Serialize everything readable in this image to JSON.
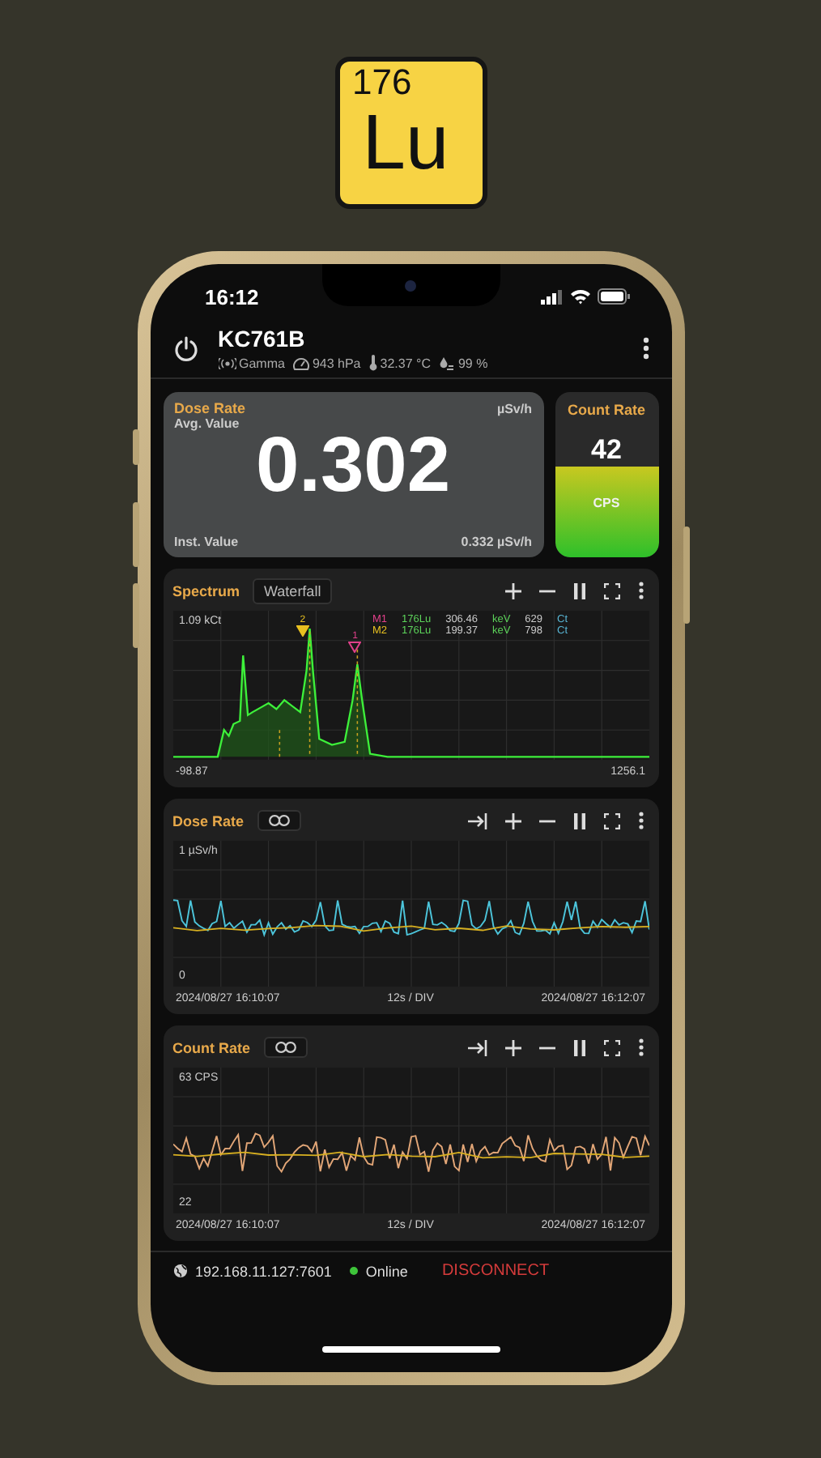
{
  "logo": {
    "mass_number": "176",
    "symbol": "Lu"
  },
  "status_bar": {
    "time": "16:12"
  },
  "device": {
    "name": "KC761B",
    "mode": "Gamma",
    "pressure": "943 hPa",
    "temperature": "32.37 °C",
    "humidity": "99 %"
  },
  "dose_card": {
    "title": "Dose Rate",
    "unit": "µSv/h",
    "avg_label": "Avg. Value",
    "value": "0.302",
    "inst_label": "Inst. Value",
    "inst_value": "0.332 µSv/h"
  },
  "count_card": {
    "title": "Count Rate",
    "value": "42",
    "unit": "CPS",
    "level": 0.55
  },
  "spectrum": {
    "title": "Spectrum",
    "tab": "Waterfall",
    "y_label": "1.09 kCt",
    "x_min": "-98.87",
    "x_max": "1256.1",
    "markers": [
      {
        "name": "M1",
        "isotope": "176Lu",
        "energy": "306.46",
        "energy_unit": "keV",
        "counts": "629",
        "counts_unit": "Ct",
        "plot_label": "1",
        "color": "#e0408a"
      },
      {
        "name": "M2",
        "isotope": "176Lu",
        "energy": "199.37",
        "energy_unit": "keV",
        "counts": "798",
        "counts_unit": "Ct",
        "plot_label": "2",
        "color": "#e8c020"
      }
    ]
  },
  "trends": [
    {
      "kind": "dose",
      "title": "Dose Rate",
      "y_max": "1 µSv/h",
      "y_min": "0",
      "start": "2024/08/27 16:10:07",
      "div": "12s / DIV",
      "end": "2024/08/27 16:12:07"
    },
    {
      "kind": "count",
      "title": "Count Rate",
      "y_max": "63 CPS",
      "y_min": "22",
      "start": "2024/08/27 16:10:07",
      "div": "12s / DIV",
      "end": "2024/08/27 16:12:07"
    }
  ],
  "footer": {
    "address": "192.168.11.127:7601",
    "online": true,
    "status": "Online",
    "action": "DISCONNECT"
  }
}
